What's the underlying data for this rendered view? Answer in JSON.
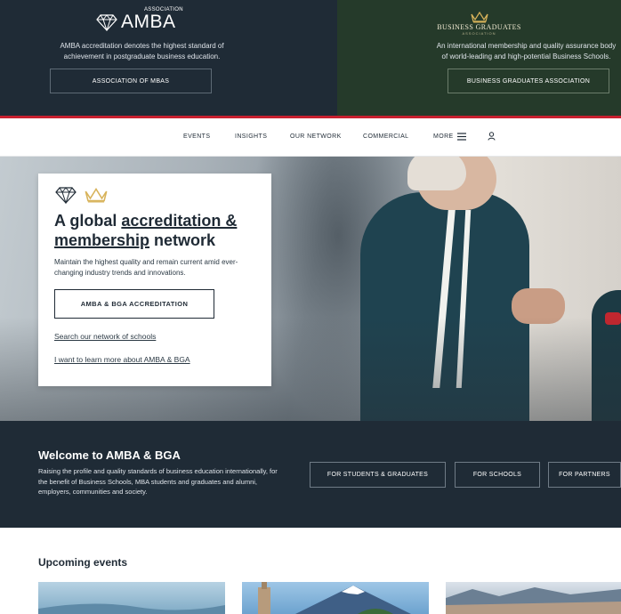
{
  "top": {
    "amba": {
      "logo_word": "AMBA",
      "logo_small": "ASSOCIATION",
      "description": "AMBA accreditation denotes the highest standard of achievement in postgraduate business education.",
      "button": "ASSOCIATION OF MBAS"
    },
    "bga": {
      "logo_title": "BUSINESS GRADUATES",
      "logo_sub": "ASSOCIATION",
      "description": "An international membership and quality assurance body of world-leading and high-potential Business Schools.",
      "button": "BUSINESS GRADUATES ASSOCIATION"
    }
  },
  "nav": {
    "items": [
      "EVENTS",
      "INSIGHTS",
      "OUR NETWORK",
      "COMMERCIAL",
      "MORE"
    ]
  },
  "hero": {
    "title_part1": "A global ",
    "title_link1": "accreditation &",
    "title_link2": "membership",
    "title_part2": " network",
    "lead": "Maintain the highest quality and remain current amid ever-changing industry trends and innovations.",
    "cta": "AMBA & BGA ACCREDITATION",
    "link1": "Search our network of schools",
    "link2": "I want to learn more about AMBA & BGA"
  },
  "welcome": {
    "title": "Welcome to AMBA & BGA",
    "text": "Raising the profile and quality standards of business education internationally, for the benefit of Business Schools, MBA students and graduates and alumni, employers, communities and society.",
    "buttons": [
      "FOR STUDENTS & GRADUATES",
      "FOR SCHOOLS",
      "FOR PARTNERS"
    ]
  },
  "upcoming": {
    "title": "Upcoming events"
  },
  "colors": {
    "navy": "#1f2b36",
    "green": "#253a2a",
    "accent_red": "#c8202f",
    "gold": "#d8b35a"
  }
}
